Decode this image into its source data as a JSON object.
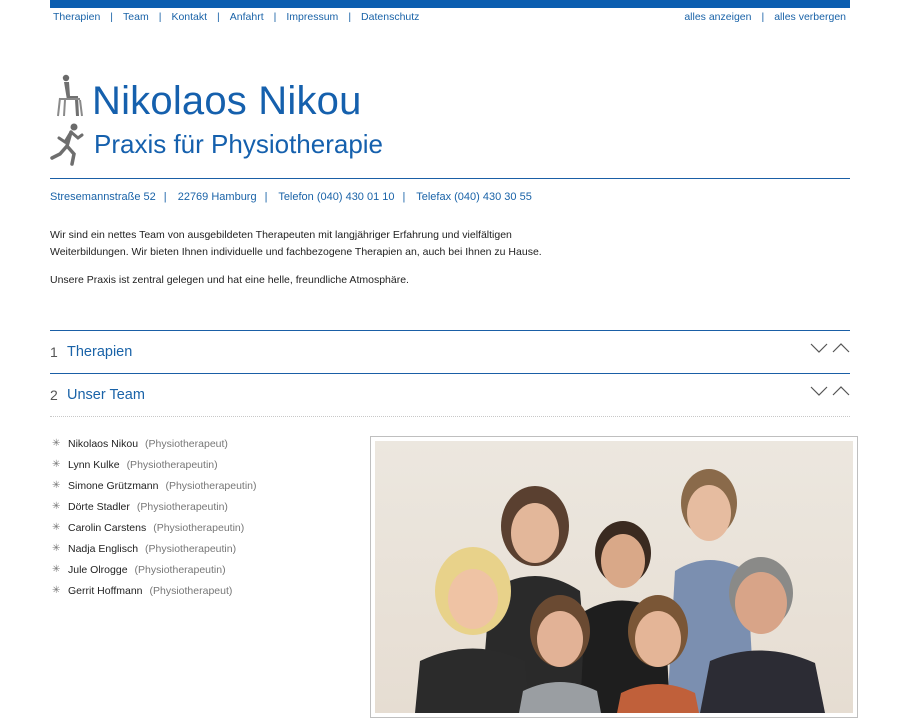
{
  "topnav": {
    "left": [
      "Therapien",
      "Team",
      "Kontakt",
      "Anfahrt",
      "Impressum",
      "Datenschutz"
    ],
    "right": [
      "alles anzeigen",
      "alles verbergen"
    ]
  },
  "header": {
    "name": "Nikolaos Nikou",
    "subtitle": "Praxis für Physiotherapie"
  },
  "contact": {
    "street": "Stresemannstraße 52",
    "city": "22769 Hamburg",
    "phone": "Telefon (040) 430 01 10",
    "fax": "Telefax (040) 430 30 55"
  },
  "intro": {
    "p1": "Wir sind ein nettes Team von ausgebildeten Therapeuten mit langjähriger Erfahrung und vielfältigen Weiterbildungen. Wir bieten Ihnen individuelle und fachbezogene Therapien an, auch bei Ihnen zu Hause.",
    "p2": "Unsere Praxis ist zentral gelegen und hat eine helle, freundliche Atmosphäre."
  },
  "sections": [
    {
      "num": "1",
      "title": "Therapien"
    },
    {
      "num": "2",
      "title": "Unser Team"
    }
  ],
  "team": [
    {
      "name": "Nikolaos Nikou",
      "role": "(Physiotherapeut)"
    },
    {
      "name": "Lynn Kulke",
      "role": "(Physiotherapeutin)"
    },
    {
      "name": "Simone Grützmann",
      "role": "(Physiotherapeutin)"
    },
    {
      "name": "Dörte Stadler",
      "role": "(Physiotherapeutin)"
    },
    {
      "name": "Carolin Carstens",
      "role": "(Physiotherapeutin)"
    },
    {
      "name": "Nadja Englisch",
      "role": "(Physiotherapeutin)"
    },
    {
      "name": "Jule Olrogge",
      "role": "(Physiotherapeutin)"
    },
    {
      "name": "Gerrit Hoffmann",
      "role": "(Physiotherapeut)"
    }
  ],
  "colors": {
    "accent": "#1560ad",
    "topbar": "#0b5eb0"
  }
}
